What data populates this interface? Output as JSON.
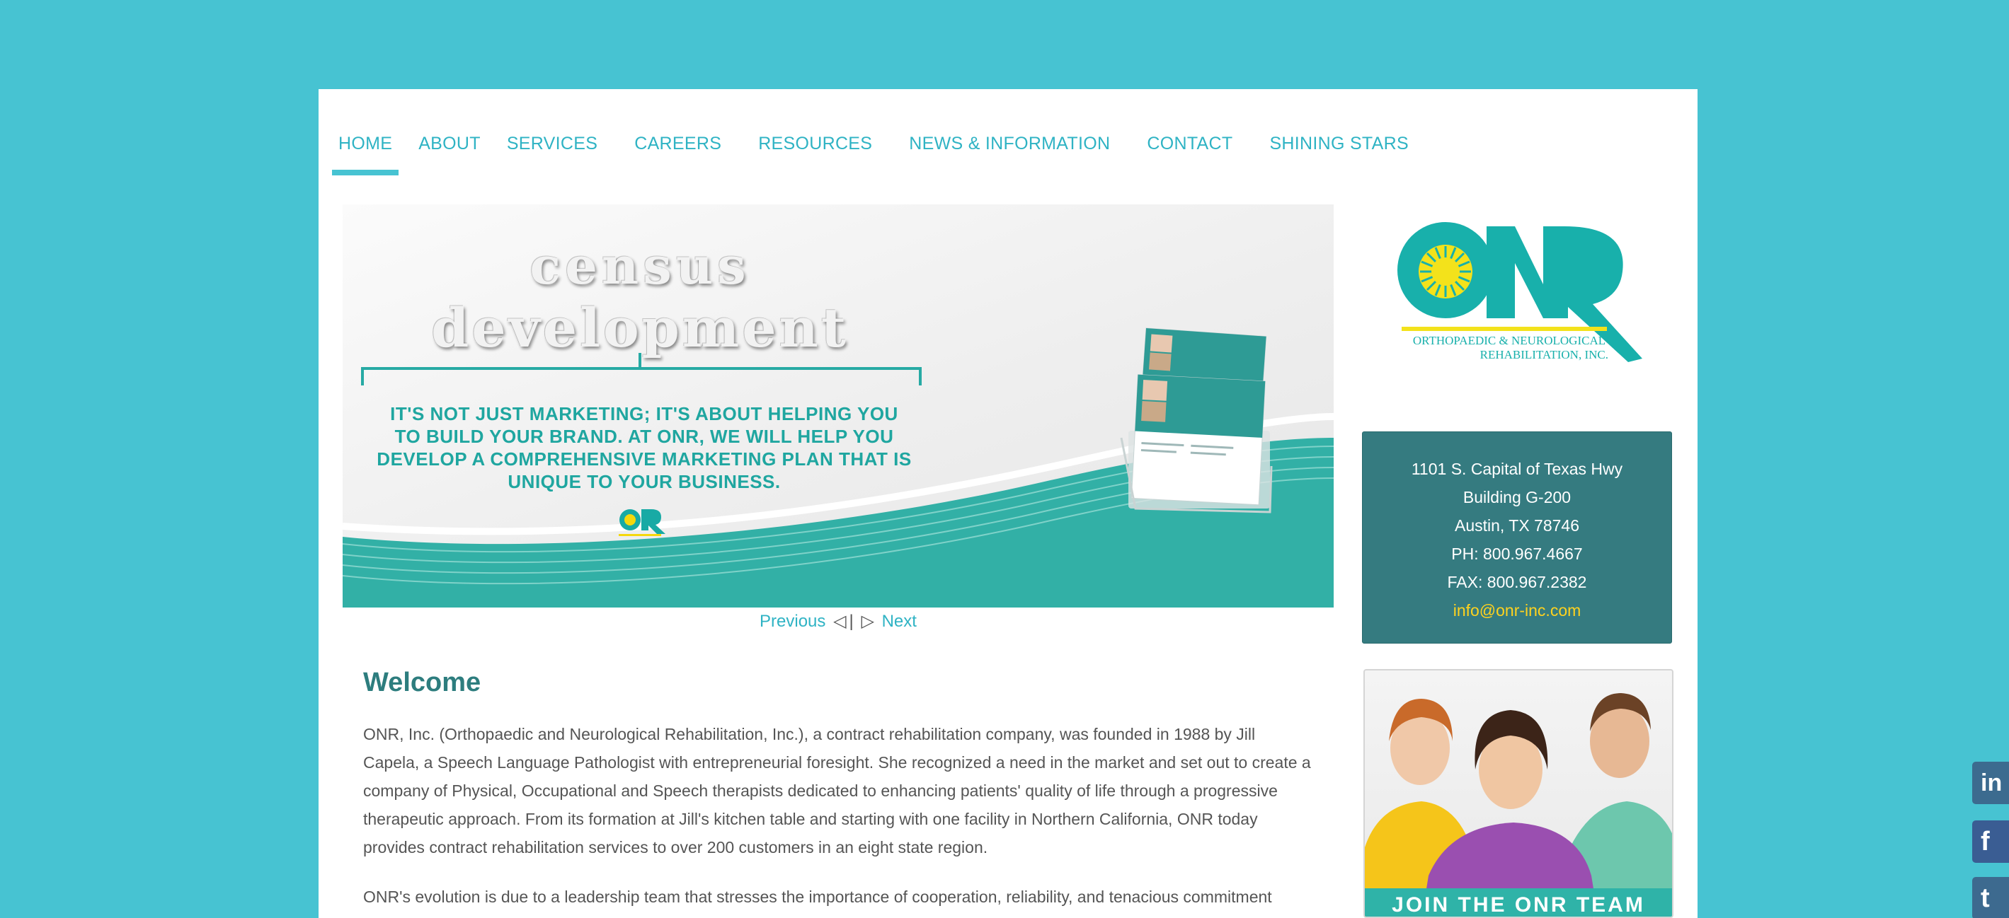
{
  "nav": {
    "items": [
      {
        "label": "HOME",
        "active": true
      },
      {
        "label": "ABOUT"
      },
      {
        "label": "SERVICES"
      },
      {
        "label": "CAREERS"
      },
      {
        "label": "RESOURCES"
      },
      {
        "label": "NEWS & INFORMATION"
      },
      {
        "label": "CONTACT"
      },
      {
        "label": "SHINING STARS"
      }
    ]
  },
  "slider": {
    "title_line1": "census",
    "title_line2": "development",
    "body": "IT'S NOT JUST MARKETING; IT'S ABOUT HELPING YOU TO BUILD YOUR BRAND. AT ONR, WE WILL HELP YOU DEVELOP A COMPREHENSIVE MARKETING PLAN THAT IS UNIQUE TO YOUR BUSINESS.",
    "mini_logo_text": "ONR",
    "prev_label": "Previous",
    "prev_symbol": "◁",
    "separator": "|",
    "next_symbol": "▷",
    "next_label": "Next"
  },
  "welcome": {
    "title": "Welcome",
    "para1": "ONR, Inc. (Orthopaedic and Neurological Rehabilitation, Inc.), a contract rehabilitation company, was founded in 1988 by Jill Capela, a Speech Language Pathologist with entrepreneurial foresight. She recognized a need in the market and set out to create a company of Physical, Occupational and Speech therapists dedicated to enhancing patients' quality of life through a progressive therapeutic approach. From its formation at Jill's kitchen table and starting with one facility in Northern California, ONR today provides contract rehabilitation services to over 200 customers in an eight state region.",
    "para2": "ONR's evolution is due to a leadership team that stresses the importance of cooperation, reliability, and tenacious commitment"
  },
  "logo": {
    "letters": "ONR",
    "line1": "ORTHOPAEDIC & NEUROLOGICAL",
    "line2": "REHABILITATION, INC."
  },
  "address": {
    "line1": "1101 S. Capital of Texas Hwy",
    "line2": "Building G-200",
    "line3": "Austin, TX  78746",
    "phone": "PH: 800.967.4667",
    "fax": "FAX: 800.967.2382",
    "email": "info@onr-inc.com"
  },
  "team": {
    "banner": "JOIN THE ONR TEAM"
  },
  "social": {
    "linkedin": "in",
    "facebook": "f",
    "twitter": "t"
  },
  "colors": {
    "background": "#47c3d2",
    "accent": "#2fb3c4",
    "address_box": "#357b80",
    "email": "#ffd21e",
    "heading": "#2d7d7e"
  }
}
